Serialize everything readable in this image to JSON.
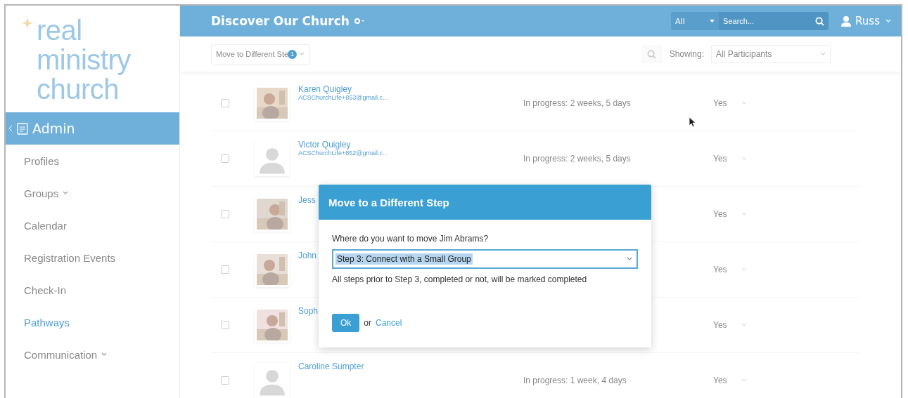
{
  "logo": {
    "lines": [
      "real",
      "ministry",
      "church"
    ]
  },
  "sidebar": {
    "section": {
      "label": "Admin",
      "selected": true
    },
    "items": [
      {
        "label": "Profiles",
        "selected": false,
        "has_children": false
      },
      {
        "label": "Groups",
        "selected": false,
        "has_children": true
      },
      {
        "label": "Calendar",
        "selected": false,
        "has_children": false
      },
      {
        "label": "Registration Events",
        "selected": false,
        "has_children": false
      },
      {
        "label": "Check-In",
        "selected": false,
        "has_children": false
      },
      {
        "label": "Pathways",
        "selected": true,
        "has_children": false
      },
      {
        "label": "Communication",
        "selected": false,
        "has_children": true
      }
    ]
  },
  "header": {
    "title": "Discover Our Church",
    "scope": "All",
    "search": {
      "placeholder": "Search..."
    },
    "user": "Russ"
  },
  "toolbar": {
    "action": "Move to Different Ste",
    "badge": "1",
    "showing_label": "Showing:",
    "showing_value": "All Participants"
  },
  "rows": [
    {
      "checked": false,
      "name": "Karen Quigley",
      "email": "ACSChurchLife+853@gmail.c...",
      "status": "In progress: 2 weeks, 5 days",
      "column_4": "Yes"
    },
    {
      "checked": false,
      "kind": "silhouette",
      "name": "Victor Quigley",
      "email": "ACSChurchLife+852@gmail.c...",
      "status": "In progress: 2 weeks, 5 days",
      "column_4": "Yes"
    },
    {
      "checked": false,
      "name": "Jess",
      "column_4": "Yes"
    },
    {
      "checked": false,
      "name": "John",
      "column_4": "Yes"
    },
    {
      "checked": false,
      "name": "Soph",
      "column_4": "Yes"
    },
    {
      "checked": false,
      "kind": "silhouette",
      "name": "Caroline Sumpter",
      "status": "In progress: 1 week, 4 days",
      "column_4": "Yes"
    }
  ],
  "dialog": {
    "title": "Move to a Different Step",
    "question": "Where do you want to move Jim Abrams?",
    "step": "Step 3: Connect with a Small Group",
    "note": "All steps prior to Step 3, completed or not, will be marked completed",
    "ok": "Ok",
    "or": "or",
    "cancel": "Cancel"
  }
}
